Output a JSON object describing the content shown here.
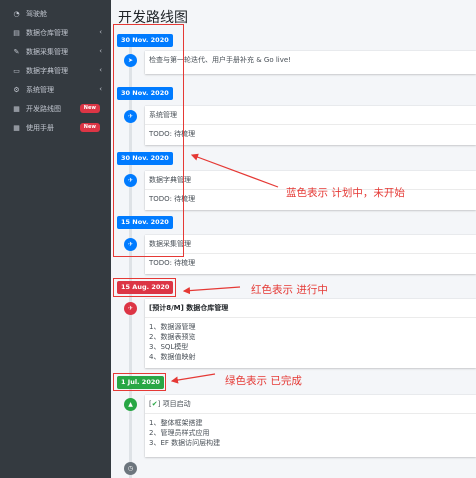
{
  "sidebar": {
    "items": [
      {
        "label": "驾驶舱",
        "icon": "dashboard-icon",
        "glyph": "◔",
        "chevron": false
      },
      {
        "label": "数据仓库管理",
        "icon": "database-icon",
        "glyph": "▤",
        "chevron": true
      },
      {
        "label": "数据采集管理",
        "icon": "edit-icon",
        "glyph": "✎",
        "chevron": true
      },
      {
        "label": "数据字典管理",
        "icon": "file-icon",
        "glyph": "▭",
        "chevron": true
      },
      {
        "label": "系统管理",
        "icon": "gear-icon",
        "glyph": "⚙",
        "chevron": true
      },
      {
        "label": "开发路线图",
        "icon": "roadmap-icon",
        "glyph": "▦",
        "badge": "New"
      },
      {
        "label": "使用手册",
        "icon": "manual-icon",
        "glyph": "▦",
        "badge": "New"
      }
    ]
  },
  "main": {
    "title": "开发路线图",
    "timeline": [
      {
        "date": "30 Nov. 2020",
        "status": "blue"
      },
      {
        "date": "30 Nov. 2020",
        "status": "blue"
      },
      {
        "date": "30 Nov. 2020",
        "status": "blue"
      },
      {
        "date": "15 Nov. 2020",
        "status": "blue"
      },
      {
        "date": "15 Aug. 2020",
        "status": "red"
      },
      {
        "date": "1 Jul. 2020",
        "status": "green"
      }
    ],
    "cards": [
      {
        "header": "检查与第一轮迭代、用户手册补充 & Go live!"
      },
      {
        "header": "系统管理",
        "body": [
          "TODO: 待梳理"
        ]
      },
      {
        "header": "数据字典管理",
        "body": [
          "TODO: 待梳理"
        ]
      },
      {
        "header": "数据采集管理",
        "body": [
          "TODO: 待梳理"
        ]
      },
      {
        "header": "[预计8/M] 数据仓库管理",
        "body": [
          "1、数据源管理",
          "2、数据表预览",
          "3、SQL模型",
          "4、数据值映射"
        ]
      },
      {
        "header_prefix": "[",
        "header_check": "✔",
        "header_suffix": "] 项目启动",
        "body": [
          "1、整体框架搭建",
          "2、管理员样式应用",
          "3、EF 数据访问层构建"
        ]
      }
    ]
  },
  "annotations": {
    "blue_note": "蓝色表示  计划中，未开始",
    "red_note": "红色表示  进行中",
    "green_note": "绿色表示  已完成",
    "color": "#e53935"
  },
  "colors": {
    "blue": "#007bff",
    "red": "#dc3545",
    "green": "#28a745",
    "sidebar_bg": "#343a40"
  }
}
